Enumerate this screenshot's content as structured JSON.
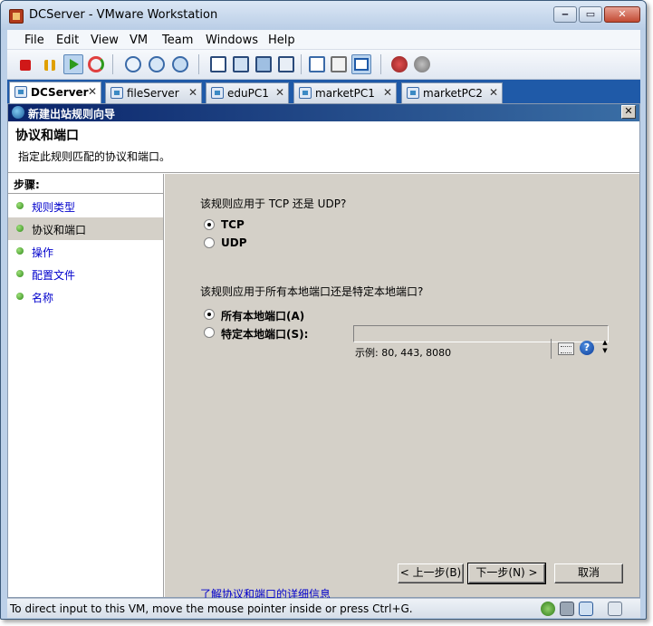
{
  "window": {
    "title": "DCServer - VMware Workstation"
  },
  "menu": [
    "File",
    "Edit",
    "View",
    "VM",
    "Team",
    "Windows",
    "Help"
  ],
  "tabs": [
    {
      "label": "DCServer",
      "active": true
    },
    {
      "label": "fileServer",
      "active": false
    },
    {
      "label": "eduPC1",
      "active": false
    },
    {
      "label": "marketPC1",
      "active": false
    },
    {
      "label": "marketPC2",
      "active": false
    }
  ],
  "dialog": {
    "title": "新建出站规则向导",
    "close": "✕",
    "header_title": "协议和端口",
    "header_desc": "指定此规则匹配的协议和端口。",
    "steps_heading": "步骤:",
    "steps": [
      "规则类型",
      "协议和端口",
      "操作",
      "配置文件",
      "名称"
    ],
    "q1": "该规则应用于 TCP 还是 UDP?",
    "protocol_options": [
      "TCP",
      "UDP"
    ],
    "selected_protocol": "TCP",
    "q2": "该规则应用于所有本地端口还是特定本地端口?",
    "port_options": [
      "所有本地端口(A)",
      "特定本地端口(S):"
    ],
    "selected_port": "所有本地端口(A)",
    "port_value": "",
    "example": "示例: 80, 443, 8080",
    "help_glyph": "?",
    "more_link": "了解协议和端口的详细信息",
    "buttons": {
      "back": "< 上一步(B)",
      "next": "下一步(N) >",
      "cancel": "取消"
    }
  },
  "status": {
    "text": "To direct input to this VM, move the mouse pointer inside or press Ctrl+G."
  },
  "colors": {
    "tab_strip": "#1f5aa8",
    "dialog_title": "#0a246a",
    "step_dot": "#2e8a18",
    "link": "#0000cc"
  }
}
